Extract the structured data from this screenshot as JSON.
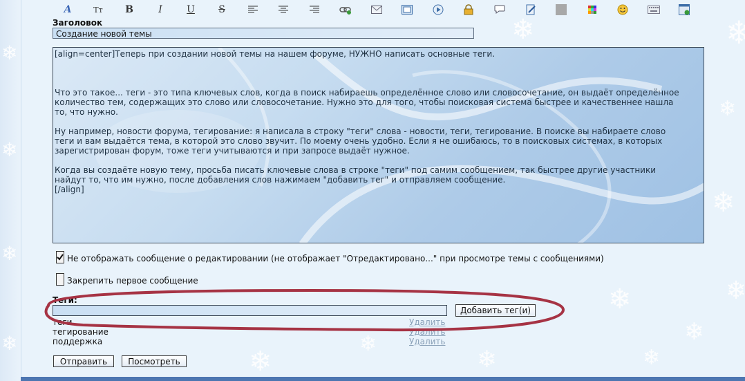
{
  "toolbar": {
    "buttons": [
      {
        "name": "font-style-icon",
        "glyph": "A"
      },
      {
        "name": "font-size-icon",
        "glyph": "Tт"
      },
      {
        "name": "bold-icon",
        "glyph": "B"
      },
      {
        "name": "italic-icon",
        "glyph": "I"
      },
      {
        "name": "underline-icon",
        "glyph": "U"
      },
      {
        "name": "strikethrough-icon",
        "glyph": "S"
      }
    ]
  },
  "title": {
    "label": "Заголовок",
    "value": "Создание новой темы"
  },
  "message": {
    "text": "[align=center]Теперь при создании новой темы на нашем форуме, НУЖНО написать основные теги.\n\n\n\nЧто это такое... теги - это типа ключевых слов, когда в поиск набираешь определённое слово или словосочетание, он выдаёт определённое\nколичество тем, содержащих это слово или словосочетание. Нужно это для того, чтобы поисковая система быстрее и качественнее нашла\nто, что нужно.\n\nНу например, новости форума, тегирование: я написала в строку \"теги\" слова - новости, теги, тегирование. В поиске вы набираете слово\nтеги и вам выдаётся тема, в которой это слово звучит. По моему очень удобно. Если я не ошибаюсь, то в поисковых системах, в которых\nзарегистрирован форум, тоже теги учитываются и при запросе выдаёт нужное.\n\nКогда вы создаёте новую тему, просьба писать ключевые слова в строке \"теги\" под самим сообщением, так быстрее другие участники\nнайдут то, что им нужно, после добавления слов нажимаем \"добавить тег\" и отправляем сообщение.\n[/align]"
  },
  "options": {
    "hide_edit_notice": {
      "label": "Не отображать сообщение о редактировании (не отображает \"Отредактировано...\" при просмотре темы с сообщениями)",
      "checked": true
    },
    "pin_first_post": {
      "label": "Закрепить первое сообщение",
      "checked": false
    }
  },
  "tags": {
    "label": "Теги:",
    "input_value": "",
    "add_button": "Добавить тег(и)",
    "delete_label": "Удалить",
    "list": [
      "теги",
      "тегирование",
      "поддержка"
    ]
  },
  "actions": {
    "submit": "Отправить",
    "preview": "Посмотреть"
  },
  "colors": {
    "annotation": "#a63344",
    "accent": "#4d76b1"
  }
}
